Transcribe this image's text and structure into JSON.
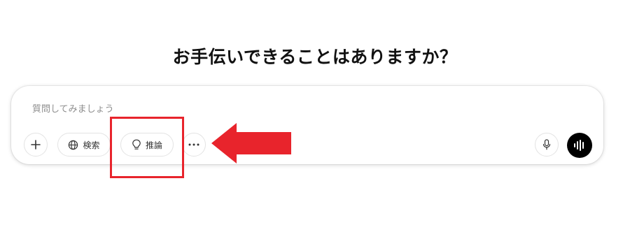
{
  "heading": "お手伝いできることはありますか？",
  "composer": {
    "placeholder": "質問してみましょう",
    "buttons": {
      "add_icon": "plus-icon",
      "search_label": "検索",
      "search_icon": "globe-icon",
      "reason_label": "推論",
      "reason_icon": "lightbulb-icon",
      "more_icon": "ellipsis-icon",
      "mic_icon": "microphone-icon",
      "voice_icon": "voice-waveform-icon"
    }
  },
  "annotation": {
    "highlight_color": "#e8242c",
    "arrow_color": "#e8242c"
  }
}
